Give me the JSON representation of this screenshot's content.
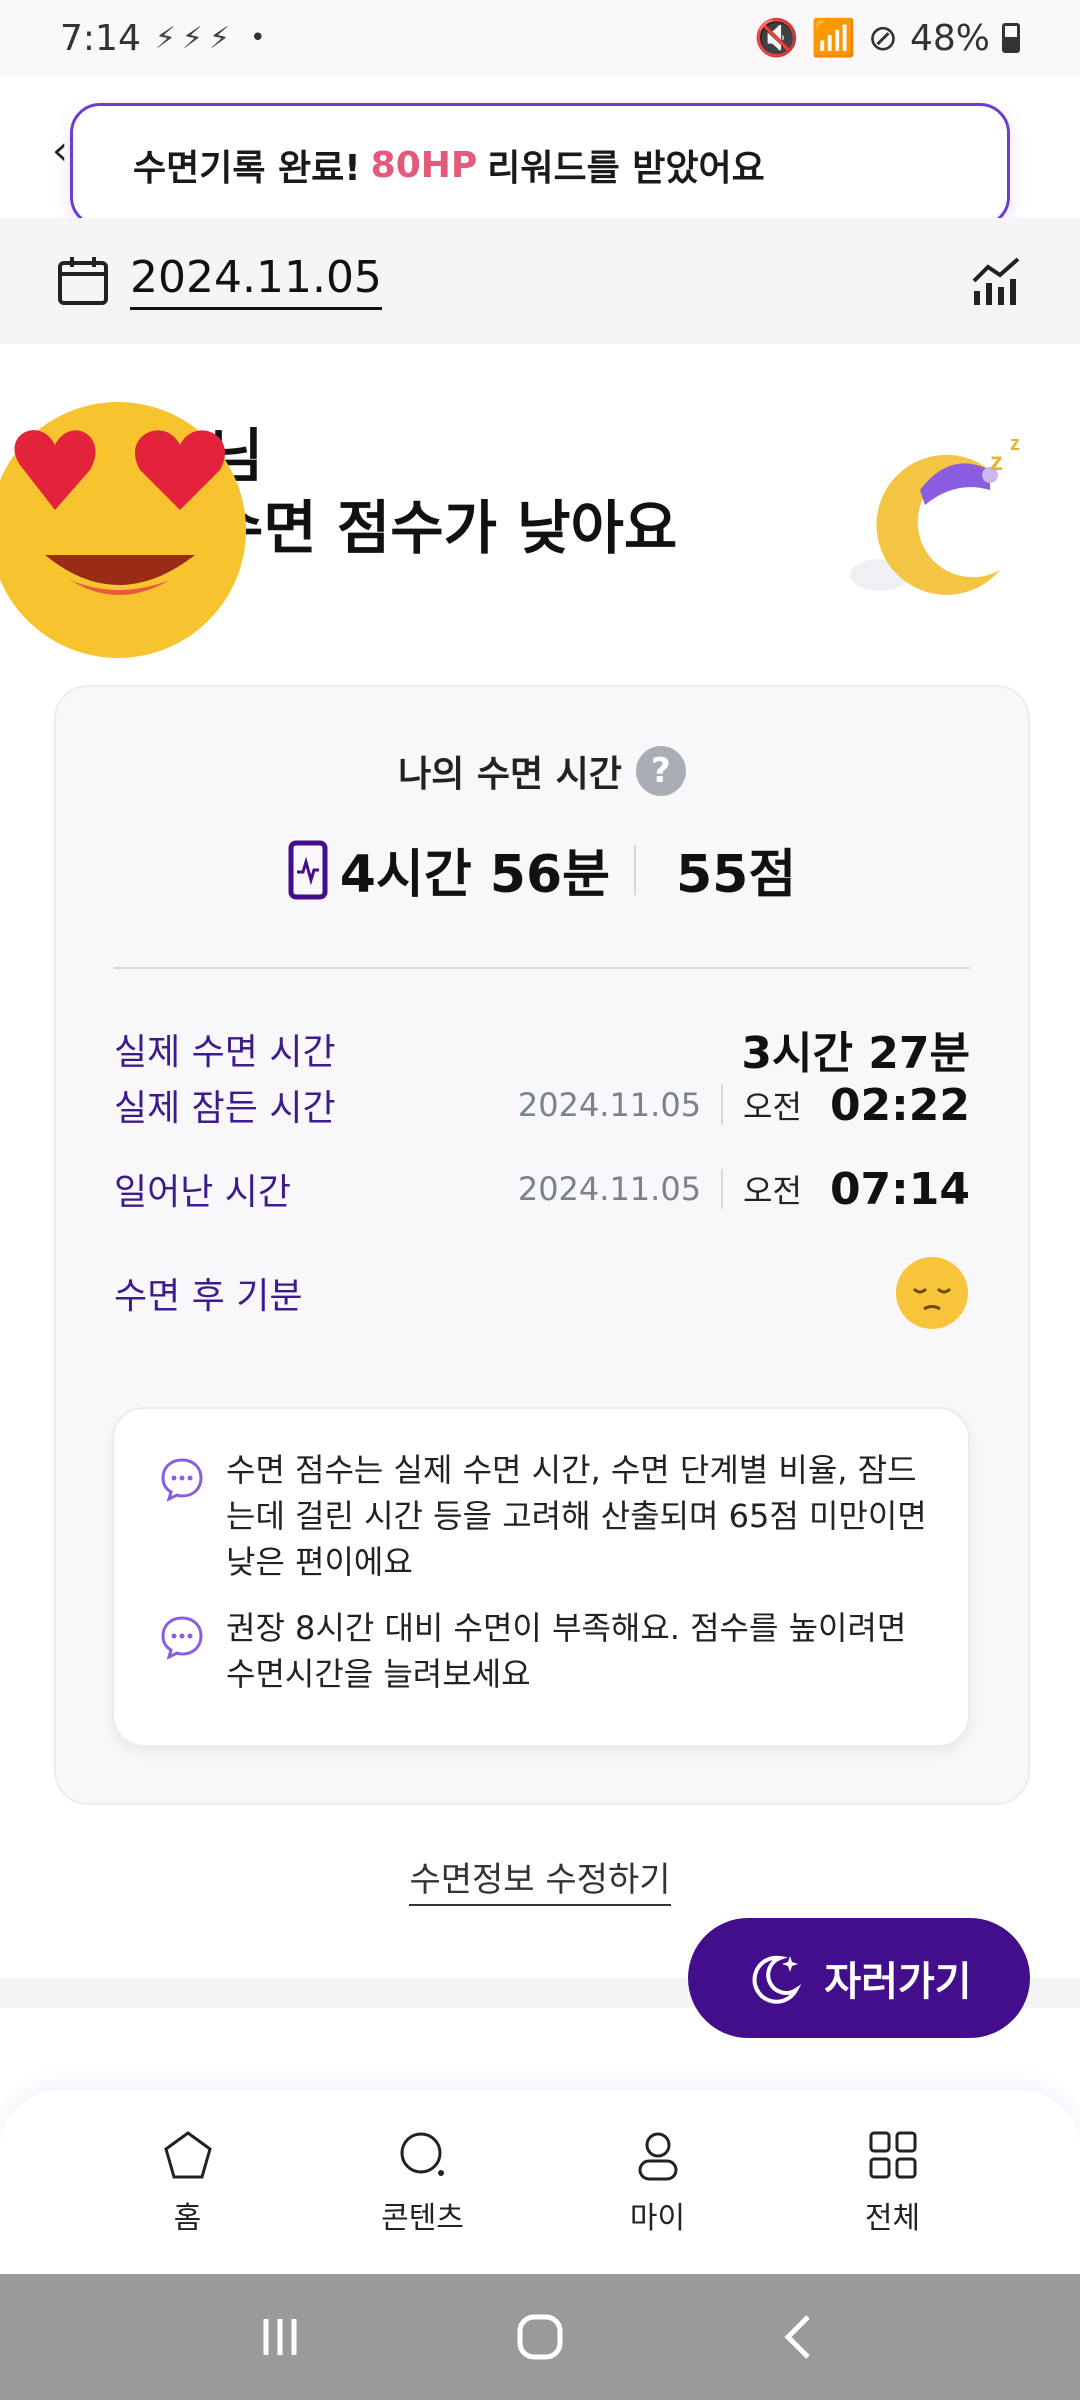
{
  "status": {
    "time": "7:14",
    "notif_icons": [
      "app-notification-icon",
      "app-notification-icon",
      "app-notification-icon"
    ],
    "battery": "48%"
  },
  "toast": {
    "prefix": "수면기록 완료!",
    "hp": "80HP",
    "suffix": "리워드를 받았어요",
    "accent_color": "#e25a7c"
  },
  "date_bar": {
    "date": "2024.11.05"
  },
  "title": {
    "line1": "님",
    "line2": "수면 점수가 낮아요"
  },
  "card": {
    "heading": "나의 수면 시간",
    "help_symbol": "?",
    "total_time": "4시간 56분",
    "score": "55점",
    "rows": [
      {
        "label": "실제 수면 시간",
        "value": "3시간 27분"
      },
      {
        "label": "실제 잠든 시간",
        "date": "2024.11.05",
        "ampm": "오전",
        "value": "02:22"
      },
      {
        "label": "일어난 시간",
        "date": "2024.11.05",
        "ampm": "오전",
        "value": "07:14"
      },
      {
        "label": "수면 후 기분"
      }
    ],
    "tips": [
      "수면 점수는 실제 수면 시간, 수면 단계별 비율, 잠드는데 걸린 시간 등을 고려해 산출되며 65점 미만이면 낮은 편이에요",
      "권장 8시간 대비 수면이 부족해요. 점수를 높이려면 수면시간을 늘려보세요"
    ]
  },
  "edit_link": "수면정보 수정하기",
  "sleep_button": "자러가기",
  "nav": {
    "items": [
      {
        "label": "홈"
      },
      {
        "label": "콘텐츠"
      },
      {
        "label": "마이"
      },
      {
        "label": "전체"
      }
    ]
  },
  "colors": {
    "primary": "#430e8c",
    "label_purple": "#3d1b8c",
    "toast_border": "#6c3dd1"
  }
}
